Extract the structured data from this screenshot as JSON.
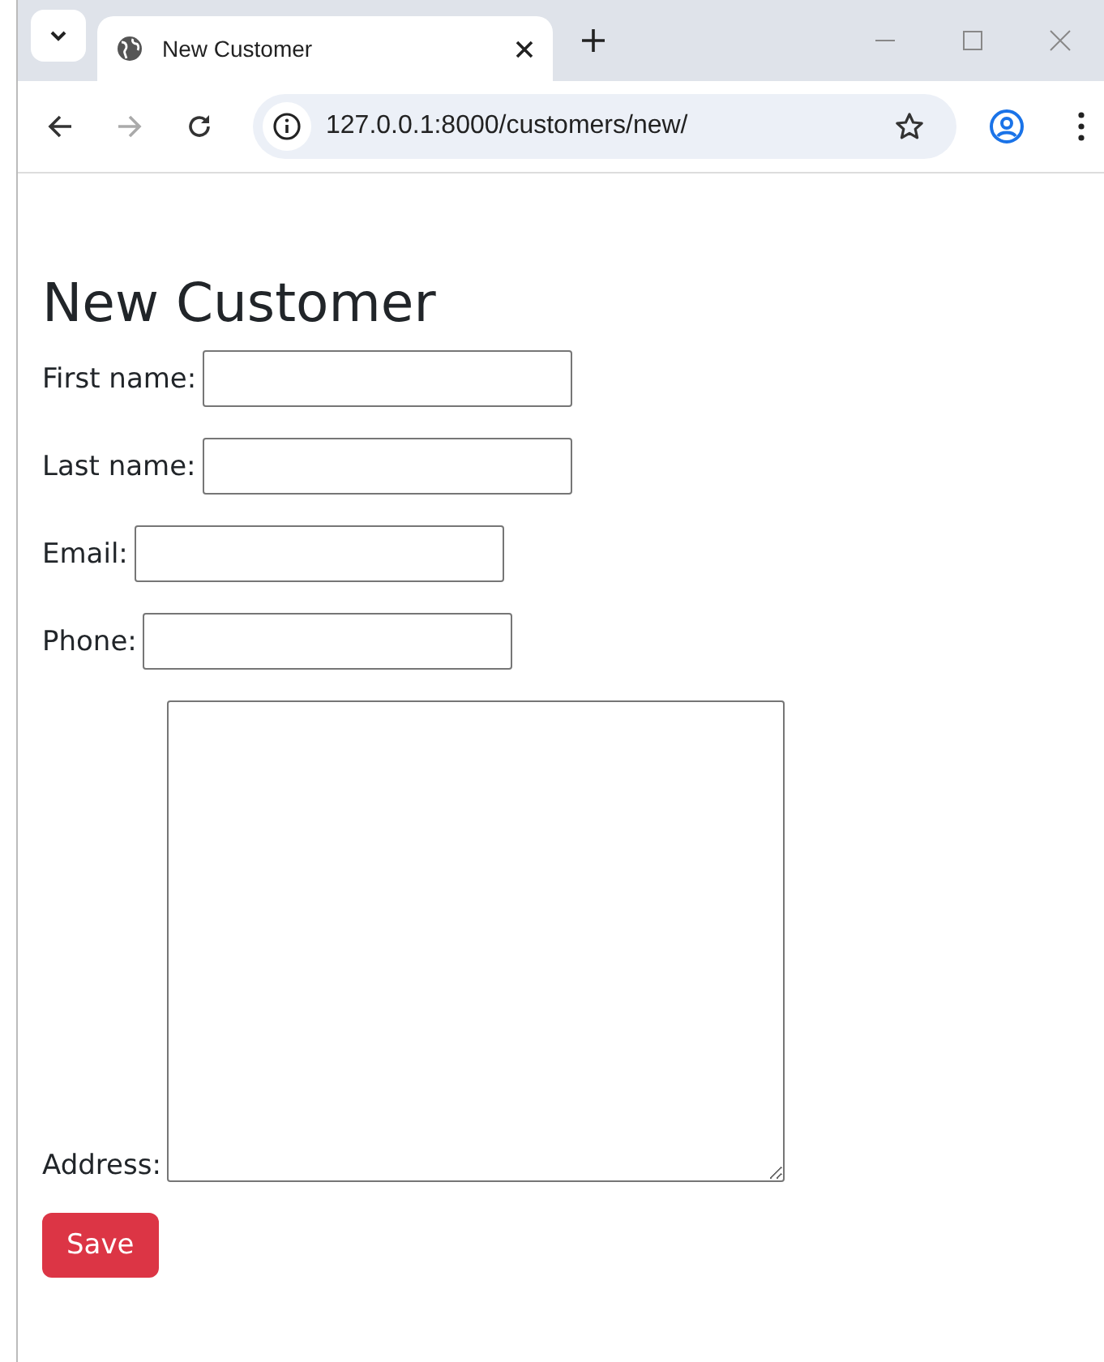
{
  "browser": {
    "tab": {
      "title": "New Customer"
    },
    "address": "127.0.0.1:8000/customers/new/",
    "nav": [
      {
        "kind": "back",
        "disabled": false
      },
      {
        "kind": "forward",
        "disabled": true
      },
      {
        "kind": "reload",
        "disabled": false
      }
    ]
  },
  "page": {
    "heading": "New Customer",
    "fields": [
      {
        "kind": "input",
        "label": "First name:"
      },
      {
        "kind": "input",
        "label": "Last name:"
      },
      {
        "kind": "input",
        "label": "Email:"
      },
      {
        "kind": "input",
        "label": "Phone:"
      },
      {
        "kind": "textarea",
        "label": "Address:"
      }
    ],
    "button": "Save"
  }
}
